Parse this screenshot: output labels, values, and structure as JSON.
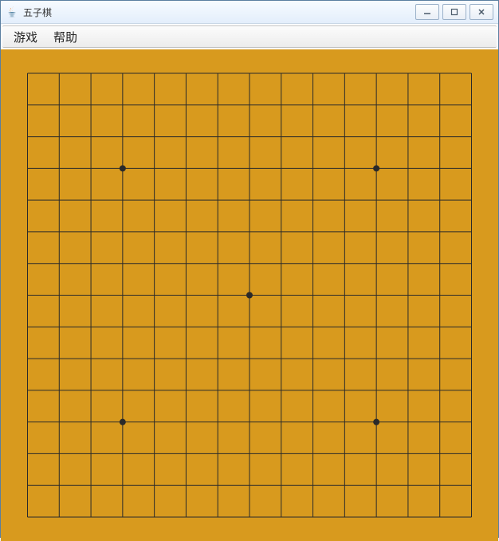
{
  "window": {
    "title": "五子棋"
  },
  "menubar": {
    "items": [
      "游戏",
      "帮助"
    ]
  },
  "board": {
    "size": 15,
    "background_color": "#d89a1e",
    "line_color": "#2a2a2a",
    "star_points": [
      {
        "col": 3,
        "row": 3
      },
      {
        "col": 11,
        "row": 3
      },
      {
        "col": 7,
        "row": 7
      },
      {
        "col": 3,
        "row": 11
      },
      {
        "col": 11,
        "row": 11
      }
    ],
    "stones": []
  }
}
